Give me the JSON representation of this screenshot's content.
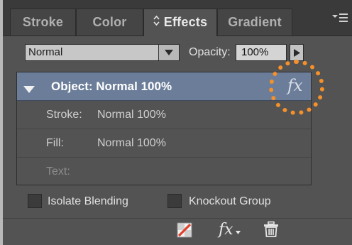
{
  "tabs": [
    {
      "label": "Stroke",
      "active": false
    },
    {
      "label": "Color",
      "active": false
    },
    {
      "label": "Effects",
      "active": true
    },
    {
      "label": "Gradient",
      "active": false
    }
  ],
  "blend": {
    "mode": "Normal",
    "opacity_label": "Opacity:",
    "opacity_value": "100%"
  },
  "appearance": {
    "object_label": "Object: Normal 100%",
    "fx_label": "fx",
    "rows": [
      {
        "key": "Stroke:",
        "value": "Normal 100%"
      },
      {
        "key": "Fill:",
        "value": "Normal 100%"
      },
      {
        "key": "Text:",
        "value": ""
      }
    ]
  },
  "options": {
    "isolate_blending": "Isolate Blending",
    "knockout_group": "Knockout Group"
  },
  "toolbar": {
    "fx_label": "fx"
  },
  "colors": {
    "panel_bg": "#535353",
    "tabbar_bg": "#3a3a3a",
    "selected_row": "#6b7d99",
    "annotation": "#f5912a",
    "clear_effects_red": "#e0402c"
  },
  "icons": {
    "tab_chevron": "updown-chevron-icon",
    "panel_menu": "panel-menu-icon",
    "dropdown": "dropdown-arrow-icon",
    "opacity_arrow": "play-arrow-icon",
    "collapse": "disclosure-triangle-icon",
    "object_fx": "fx-icon",
    "clear_effects": "clear-effects-icon",
    "add_effect": "fx-menu-icon",
    "delete": "trash-icon"
  }
}
